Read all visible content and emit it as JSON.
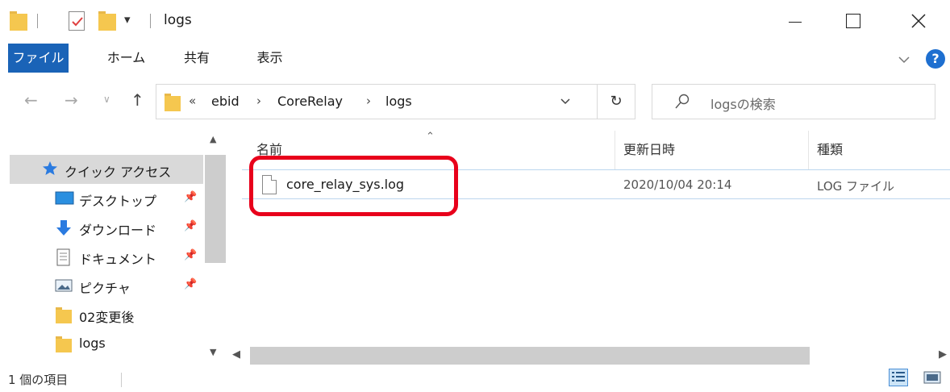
{
  "window": {
    "title": "logs",
    "qa_dropdown": "▾"
  },
  "ribbon": {
    "tabs": [
      "ファイル",
      "ホーム",
      "共有",
      "表示"
    ]
  },
  "address": {
    "overflow": "«",
    "crumbs": [
      "ebid",
      "CoreRelay",
      "logs"
    ],
    "separator": "›",
    "refresh": "↻"
  },
  "search": {
    "placeholder": "logsの検索"
  },
  "navpane": {
    "quick_access": "クイック アクセス",
    "items": [
      {
        "label": "デスクトップ",
        "icon": "desktop-icon",
        "pinned": true
      },
      {
        "label": "ダウンロード",
        "icon": "download-icon",
        "pinned": true
      },
      {
        "label": "ドキュメント",
        "icon": "documents-icon",
        "pinned": true
      },
      {
        "label": "ピクチャ",
        "icon": "pictures-icon",
        "pinned": true
      },
      {
        "label": "02変更後",
        "icon": "folder-icon",
        "pinned": false
      },
      {
        "label": "logs",
        "icon": "folder-icon",
        "pinned": false
      }
    ]
  },
  "columns": {
    "name": "名前",
    "modified": "更新日時",
    "type": "種類"
  },
  "files": [
    {
      "name": "core_relay_sys.log",
      "modified": "2020/10/04 20:14",
      "type": "LOG ファイル"
    }
  ],
  "status": {
    "count": "1 個の項目"
  },
  "colors": {
    "accent": "#1a63b7",
    "highlight_box": "#e8001b",
    "selection": "#d9d9d9"
  }
}
